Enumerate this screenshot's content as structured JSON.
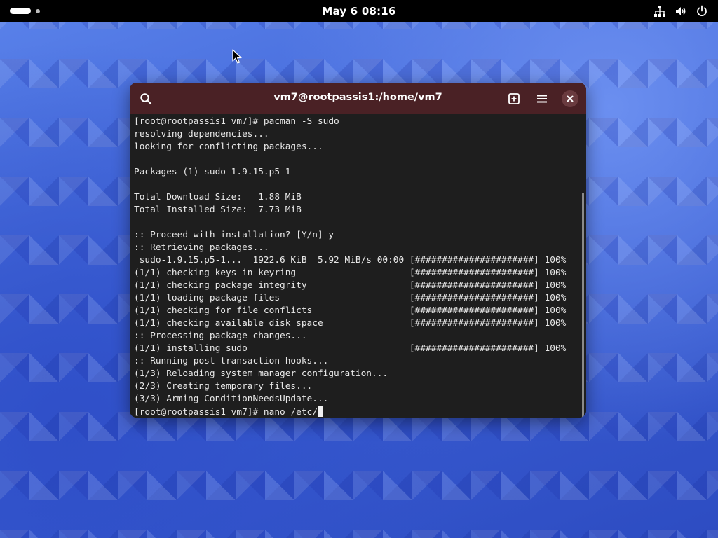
{
  "topbar": {
    "clock": "May 6  08:16",
    "tray_icons": [
      "network-icon",
      "volume-icon",
      "power-icon"
    ]
  },
  "terminal": {
    "title": "vm7@rootpassis1:/home/vm7",
    "header_colors": {
      "headerbar": "#4a2125",
      "background": "#1e1e1e",
      "text": "#e8e8e8"
    },
    "lines": [
      "[root@rootpassis1 vm7]# pacman -S sudo",
      "resolving dependencies...",
      "looking for conflicting packages...",
      "",
      "Packages (1) sudo-1.9.15.p5-1",
      "",
      "Total Download Size:   1.88 MiB",
      "Total Installed Size:  7.73 MiB",
      "",
      ":: Proceed with installation? [Y/n] y",
      ":: Retrieving packages...",
      " sudo-1.9.15.p5-1...  1922.6 KiB  5.92 MiB/s 00:00 [######################] 100%",
      "(1/1) checking keys in keyring                     [######################] 100%",
      "(1/1) checking package integrity                   [######################] 100%",
      "(1/1) loading package files                        [######################] 100%",
      "(1/1) checking for file conflicts                  [######################] 100%",
      "(1/1) checking available disk space                [######################] 100%",
      ":: Processing package changes...",
      "(1/1) installing sudo                              [######################] 100%",
      ":: Running post-transaction hooks...",
      "(1/3) Reloading system manager configuration...",
      "(2/3) Creating temporary files...",
      "(3/3) Arming ConditionNeedsUpdate..."
    ],
    "prompt_line": "[root@rootpassis1 vm7]# nano /etc/"
  }
}
